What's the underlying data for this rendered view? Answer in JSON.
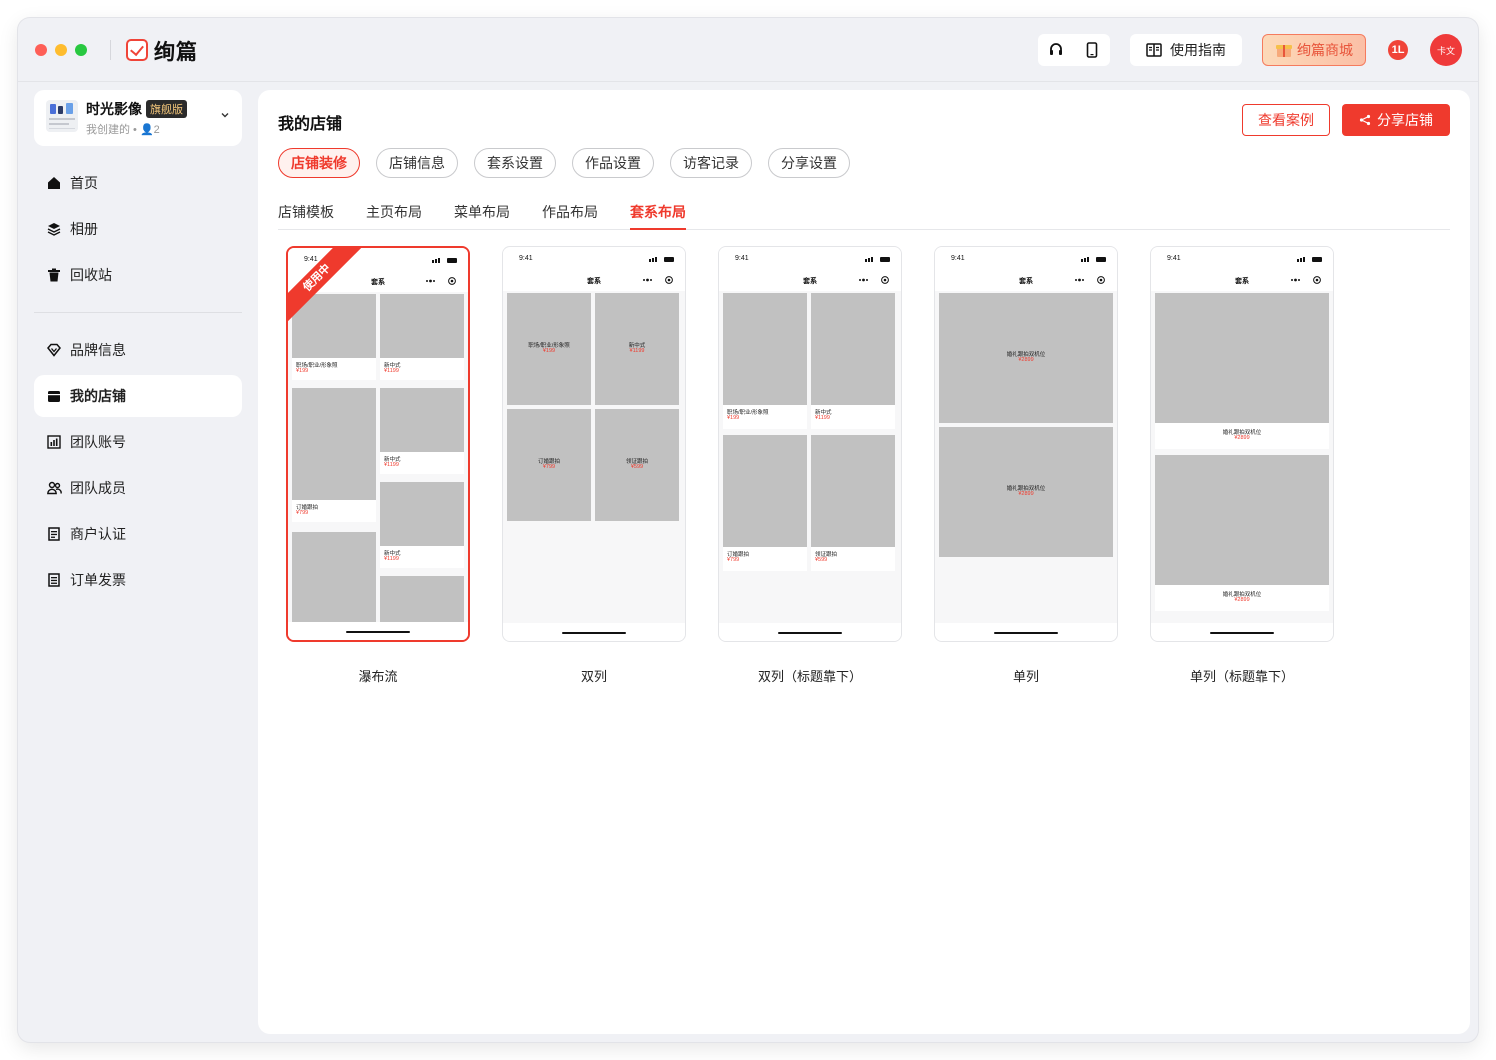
{
  "app": {
    "name": "绚篇",
    "guide_label": "使用指南",
    "mall_label": "绚篇商城",
    "notif_badge": "1L",
    "avatar_text": "卡文"
  },
  "account": {
    "name": "时光影像",
    "tag": "旗舰版",
    "subtitle": "我创建的 • 👤2"
  },
  "sidebar": {
    "items": [
      {
        "label": "首页",
        "icon": "home-icon"
      },
      {
        "label": "相册",
        "icon": "layers-icon"
      },
      {
        "label": "回收站",
        "icon": "trash-icon"
      },
      {
        "label": "品牌信息",
        "icon": "diamond-icon"
      },
      {
        "label": "我的店铺",
        "icon": "store-icon",
        "active": true
      },
      {
        "label": "团队账号",
        "icon": "chart-icon"
      },
      {
        "label": "团队成员",
        "icon": "users-icon"
      },
      {
        "label": "商户认证",
        "icon": "doc-icon"
      },
      {
        "label": "订单发票",
        "icon": "invoice-icon"
      }
    ]
  },
  "main": {
    "title": "我的店铺",
    "view_cases": "查看案例",
    "share_store": "分享店铺",
    "pills": [
      "店铺装修",
      "店铺信息",
      "套系设置",
      "作品设置",
      "访客记录",
      "分享设置"
    ],
    "subtabs": [
      "店铺模板",
      "主页布局",
      "菜单布局",
      "作品布局",
      "套系布局"
    ]
  },
  "phone": {
    "time": "9:41",
    "nav_title": "套系",
    "in_use": "使用中"
  },
  "layouts": [
    {
      "label": "瀑布流",
      "items": [
        {
          "name": "职场/职业/形象照",
          "price": "¥199"
        },
        {
          "name": "新中式",
          "price": "¥1199"
        },
        {
          "name": "新中式",
          "price": "¥1199"
        },
        {
          "name": "订婚跟拍",
          "price": "¥799"
        },
        {
          "name": "新中式",
          "price": "¥1199"
        }
      ]
    },
    {
      "label": "双列",
      "items": [
        {
          "name": "职场/职业/形象照",
          "price": "¥199"
        },
        {
          "name": "新中式",
          "price": "¥1199"
        },
        {
          "name": "订婚跟拍",
          "price": "¥799"
        },
        {
          "name": "领证跟拍",
          "price": "¥599"
        }
      ]
    },
    {
      "label": "双列（标题靠下）",
      "items": [
        {
          "name": "职场/职业/形象照",
          "price": "¥199"
        },
        {
          "name": "新中式",
          "price": "¥1199"
        },
        {
          "name": "订婚跟拍",
          "price": "¥799"
        },
        {
          "name": "领证跟拍",
          "price": "¥599"
        }
      ]
    },
    {
      "label": "单列",
      "items": [
        {
          "name": "婚礼跟拍双机位",
          "price": "¥2899"
        },
        {
          "name": "婚礼跟拍双机位",
          "price": "¥2899"
        }
      ]
    },
    {
      "label": "单列（标题靠下）",
      "items": [
        {
          "name": "婚礼跟拍双机位",
          "price": "¥2899"
        },
        {
          "name": "婚礼跟拍双机位",
          "price": "¥2899"
        }
      ]
    }
  ],
  "colors": {
    "accent": "#ef3a2d",
    "tile": "#c1c1c1",
    "sidebar_bg": "#f0f1f5"
  }
}
